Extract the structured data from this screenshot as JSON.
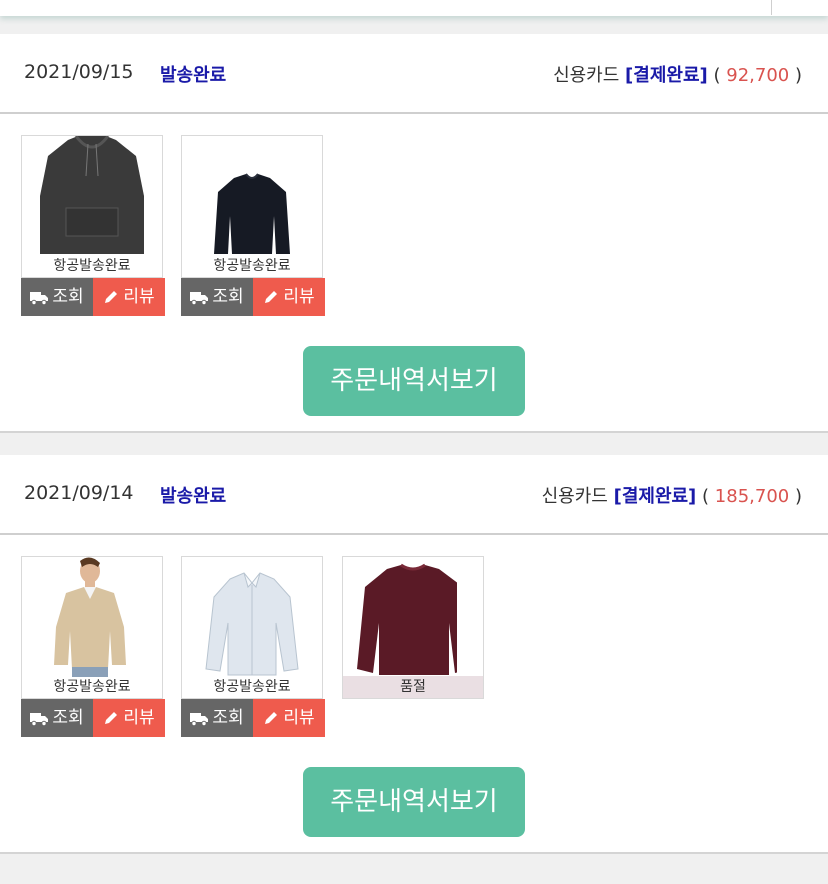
{
  "orders": [
    {
      "date": "2021/09/15",
      "status": "발송완료",
      "pay_method": "신용카드",
      "pay_status": "[결제완료]",
      "open": "(",
      "amount": "92,700",
      "close": ")",
      "items": [
        {
          "caption": "항공발송완료",
          "image": "hoodie-image",
          "color": "#3a3a3a"
        },
        {
          "caption": "항공발송완료",
          "image": "sweater-image",
          "color": "#161a24"
        }
      ],
      "track_label": "조회",
      "review_label": "리뷰",
      "detail_label": "주문내역서보기"
    },
    {
      "date": "2021/09/14",
      "status": "발송완료",
      "pay_method": "신용카드",
      "pay_status": "[결제완료]",
      "open": "(",
      "amount": "185,700",
      "close": ")",
      "items": [
        {
          "caption": "항공발송완료",
          "image": "beige-sweater-model-image",
          "color": "#d8c3a0"
        },
        {
          "caption": "항공발송완료",
          "image": "oxford-shirt-image",
          "color": "#dfe6ee"
        },
        {
          "caption": "품절",
          "image": "burgundy-sweater-image",
          "color": "#5a1a26"
        }
      ],
      "track_label": "조회",
      "review_label": "리뷰",
      "detail_label": "주문내역서보기"
    }
  ],
  "colors": {
    "status_blue": "#1a1aa8",
    "amount_red": "#d9534f",
    "track_gray": "#666666",
    "review_red": "#ef5b4d",
    "detail_teal": "#5bbfa0"
  }
}
